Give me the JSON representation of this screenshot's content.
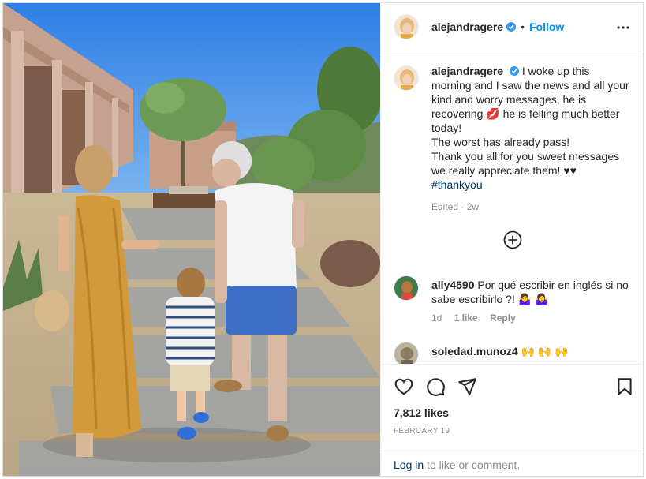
{
  "post": {
    "username": "alejandragere",
    "separator": "•",
    "follow_label": "Follow",
    "more_icon": "more-options-icon"
  },
  "caption": {
    "username": "alejandragere",
    "text_1": "I woke up this morning and I saw the news and all your kind and worry messages, he is recovering",
    "emoji_1": "💋",
    "text_2": "he is felling much better today!",
    "line_2": "The worst has already pass!",
    "line_3": "Thank you all for you sweet messages we really appreciate them!",
    "emoji_2": "♥♥",
    "hashtag": "#thankyou",
    "edited": "Edited",
    "meta_sep": "·",
    "age": "2w"
  },
  "comments": [
    {
      "username": "ally4590",
      "text": "Por qué escribir en inglés si no sabe escribirlo ?!",
      "emoji": "🤷‍♀️ 🤷‍♀️",
      "age": "1d",
      "likes": "1 like",
      "reply": "Reply"
    },
    {
      "username": "soledad.munoz4",
      "text": "",
      "emoji": "🙌 🙌 🙌"
    }
  ],
  "likes_text": "7,812 likes",
  "date_text": "FEBRUARY 19",
  "login": {
    "link": "Log in",
    "rest": " to like or comment."
  },
  "colors": {
    "accent": "#0095f6",
    "verified": "#3897f0",
    "hashtag": "#00376b"
  }
}
